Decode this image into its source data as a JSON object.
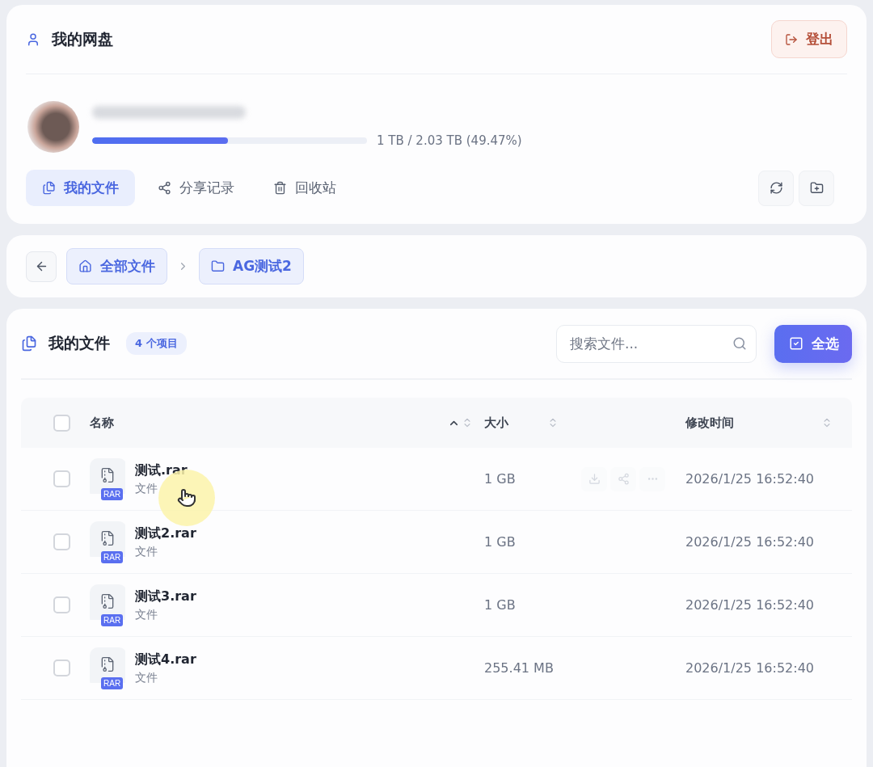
{
  "account": {
    "title": "我的网盘",
    "logout": "登出",
    "quota": {
      "level": 0.4947,
      "reading": "1 TB / 2.03 TB (49.47%)"
    },
    "tabs": [
      {
        "label": "我的文件",
        "selected": true,
        "kind": "files"
      },
      {
        "label": "分享记录",
        "selected": false,
        "kind": "share"
      },
      {
        "label": "回收站",
        "selected": false,
        "kind": "trash"
      }
    ]
  },
  "breadcrumb": [
    {
      "label": "全部文件",
      "kind": "home"
    },
    {
      "label": "AG测试2",
      "kind": "folder"
    }
  ],
  "files": {
    "title": "我的文件",
    "count": "4 个项目",
    "search": {
      "placeholder": "搜索文件..."
    },
    "select_all": "全选",
    "all_checked": false,
    "columns": [
      {
        "label": "名称",
        "sorted": true
      },
      {
        "label": "大小",
        "sorted": false
      },
      {
        "label": "修改时间",
        "sorted": false
      }
    ],
    "rows": [
      {
        "name": "测试.rar",
        "type": "文件",
        "badge": "RAR",
        "size": "1 GB",
        "modified": "2026/1/25 16:52:40",
        "checked": false,
        "hovered": true
      },
      {
        "name": "测试2.rar",
        "type": "文件",
        "badge": "RAR",
        "size": "1 GB",
        "modified": "2026/1/25 16:52:40",
        "checked": false,
        "hovered": false
      },
      {
        "name": "测试3.rar",
        "type": "文件",
        "badge": "RAR",
        "size": "1 GB",
        "modified": "2026/1/25 16:52:40",
        "checked": false,
        "hovered": false
      },
      {
        "name": "测试4.rar",
        "type": "文件",
        "badge": "RAR",
        "size": "255.41 MB",
        "modified": "2026/1/25 16:52:40",
        "checked": false,
        "hovered": false
      }
    ]
  }
}
